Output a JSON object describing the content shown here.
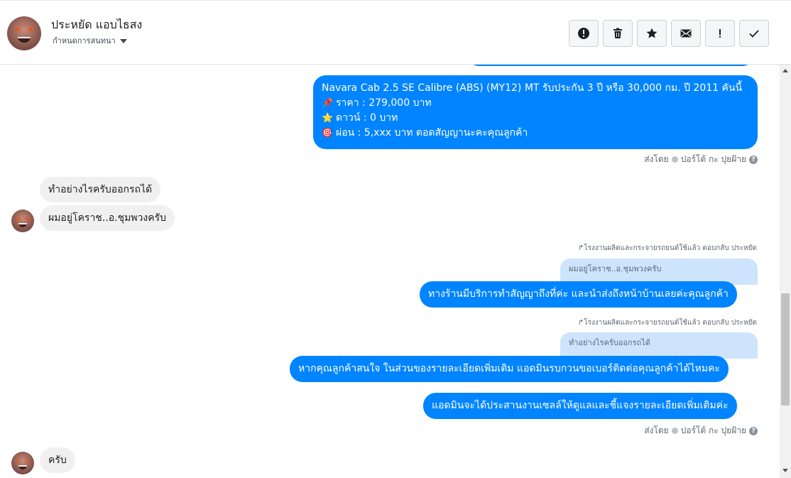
{
  "header": {
    "contact_name": "ประหยัด แอบไธสง",
    "conversation_settings_label": "กำหนดการสนทนา",
    "toolbar": [
      {
        "name": "spam-button",
        "icon": "alert-circle-icon"
      },
      {
        "name": "delete-button",
        "icon": "trash-icon"
      },
      {
        "name": "star-button",
        "icon": "star-icon"
      },
      {
        "name": "mark-unread-button",
        "icon": "envelope-icon"
      },
      {
        "name": "important-button",
        "icon": "exclamation-icon"
      },
      {
        "name": "done-button",
        "icon": "check-icon"
      }
    ]
  },
  "messages": {
    "car_offer": {
      "title": "Navara Cab 2.5 SE Calibre (ABS) (MY12) MT รับประกัน 3 ปี หรือ 30,000 กม. ปี 2011 คันนี้",
      "price": "ราคา : 279,000 บาท",
      "down": "ดาวน์ : 0 บาท",
      "installment": "ผ่อน : 5,xxx บาท ตอดสัญญานะคะคุณลูกค้า"
    },
    "sent_by_1": "ส่งโดย",
    "sent_by_name_1": "ปอร์โต้ กะ ปุยฝ้าย",
    "in_1": "ทำอย่างไรครับออกรถได้",
    "in_2": "ผมอยู่โคราช..อ.ชุมพวงครับ",
    "reply_label_1": "โรงงานผลิตและกระจายรถยนต์ใช้แล้ว ตอบกลับ ประหยัด",
    "quote_1": "ผมอยู่โคราช..อ.ชุมพวงครับ",
    "out_2": "ทางร้านมีบริการทำสัญญาถึงที่ค่ะ และนำส่งถึงหน้าบ้านเลยค่ะคุณลูกค้า",
    "reply_label_2": "โรงงานผลิตและกระจายรถยนต์ใช้แล้ว ตอบกลับ ประหยัด",
    "quote_2": "ทำอย่างไรครับออกรถได้",
    "out_3": "หากคุณลูกค้าสนใจ ในส่วนของรายละเอียดเพิ่มเติม แอดมินรบกวนขอเบอร์ติดต่อคุณลูกค้าได้ไหมคะ",
    "out_4": "แอดมินจะได้ประสานงานเซลล์ให้ดูแลและชี้แจงรายละเอียดเพิ่มเติมค่ะ",
    "sent_by_2": "ส่งโดย",
    "sent_by_name_2": "ปอร์โต้ กะ ปุยฝ้าย",
    "in_3": "ครับ"
  },
  "colors": {
    "outgoing": "#0084ff",
    "incoming": "#f0f0f0",
    "quote": "#cde4fc"
  }
}
